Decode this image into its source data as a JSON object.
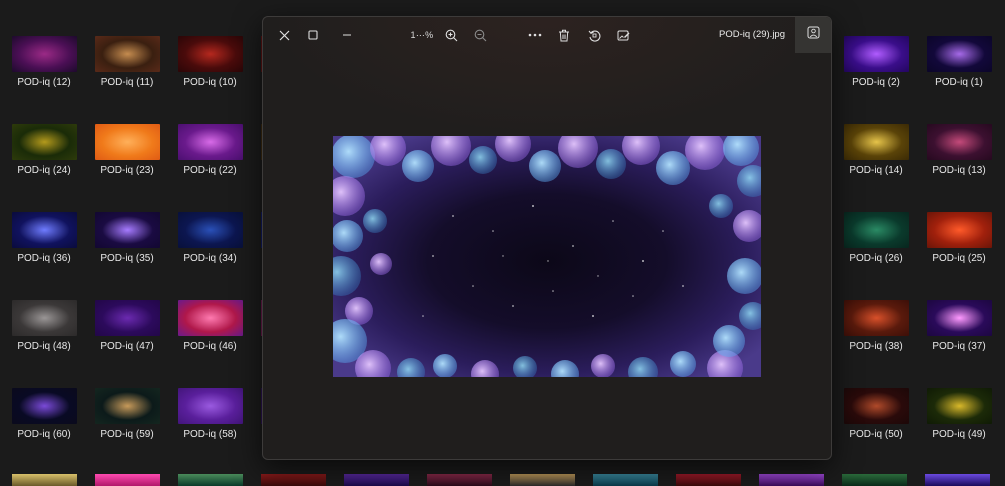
{
  "colors": {
    "background": "#1b1b1b",
    "viewer_background": "#201e1d",
    "active_button": "#353432"
  },
  "gallery": {
    "left_items": [
      {
        "label": "POD-iq (12)",
        "colors": [
          "#4b0f55",
          "#9b2a86",
          "#1d0a2c"
        ]
      },
      {
        "label": "POD-iq (11)",
        "colors": [
          "#3a1f10",
          "#c58c4f",
          "#5a2a19"
        ]
      },
      {
        "label": "POD-iq (10)",
        "colors": [
          "#4a0b0b",
          "#b5281e",
          "#2a0607"
        ]
      },
      {
        "label": "POD-iq (24)",
        "colors": [
          "#1a2b08",
          "#b49a1c",
          "#2e3b0b"
        ]
      },
      {
        "label": "POD-iq (23)",
        "colors": [
          "#f07a1a",
          "#ffb05a",
          "#e05a14"
        ]
      },
      {
        "label": "POD-iq (22)",
        "colors": [
          "#6a1a8c",
          "#d86be8",
          "#4b0f70"
        ]
      },
      {
        "label": "POD-iq (36)",
        "colors": [
          "#10125e",
          "#6f7cff",
          "#0a0b3c"
        ]
      },
      {
        "label": "POD-iq (35)",
        "colors": [
          "#1a0b42",
          "#a67bff",
          "#120731"
        ]
      },
      {
        "label": "POD-iq (34)",
        "colors": [
          "#0c1650",
          "#2a50b8",
          "#08103a"
        ]
      },
      {
        "label": "POD-iq (48)",
        "colors": [
          "#3b3838",
          "#9a9696",
          "#2c2a2a"
        ]
      },
      {
        "label": "POD-iq (47)",
        "colors": [
          "#2c0a5c",
          "#6b2ab0",
          "#220748"
        ]
      },
      {
        "label": "POD-iq (46)",
        "colors": [
          "#b0184a",
          "#ff7ab0",
          "#6a1a8c"
        ]
      },
      {
        "label": "POD-iq (60)",
        "colors": [
          "#090a24",
          "#7a4ad8",
          "#0a0a1c"
        ]
      },
      {
        "label": "POD-iq (59)",
        "colors": [
          "#0c1a1a",
          "#c79a5a",
          "#14261f"
        ]
      },
      {
        "label": "POD-iq (58)",
        "colors": [
          "#5a1f9c",
          "#9a5ae0",
          "#42157a"
        ]
      }
    ],
    "right_items": [
      {
        "label": "POD-iq (2)",
        "colors": [
          "#3a0e8a",
          "#b05cff",
          "#230660"
        ]
      },
      {
        "label": "POD-iq (1)",
        "colors": [
          "#12083a",
          "#a66ae8",
          "#0b0628"
        ]
      },
      {
        "label": "POD-iq (14)",
        "colors": [
          "#5a4308",
          "#e6c44a",
          "#3b2a05"
        ]
      },
      {
        "label": "POD-iq (13)",
        "colors": [
          "#3c1030",
          "#c44a7a",
          "#26091f"
        ]
      },
      {
        "label": "POD-iq (26)",
        "colors": [
          "#0a3a2c",
          "#2a8a64",
          "#08261e"
        ]
      },
      {
        "label": "POD-iq (25)",
        "colors": [
          "#a0200c",
          "#ff5a2a",
          "#6a1508"
        ]
      },
      {
        "label": "POD-iq (38)",
        "colors": [
          "#5a1a0c",
          "#d8502a",
          "#3c0f08"
        ]
      },
      {
        "label": "POD-iq (37)",
        "colors": [
          "#2a0a5a",
          "#ff9aff",
          "#1c0740"
        ]
      },
      {
        "label": "POD-iq (50)",
        "colors": [
          "#2a0a0a",
          "#b04a2a",
          "#1c0808"
        ]
      },
      {
        "label": "POD-iq (49)",
        "colors": [
          "#1c2a08",
          "#d8b82a",
          "#0f1a05"
        ]
      }
    ],
    "bottom_partial": [
      [
        "#6a5a2a",
        "#d8c06a"
      ],
      [
        "#b0186a",
        "#ff4ab0"
      ],
      [
        "#0a3a2a",
        "#4a8a5a"
      ],
      [
        "#3a0a0a",
        "#8a1a1a"
      ],
      [
        "#1a0a4a",
        "#5a2aa0"
      ],
      [
        "#2a0a1a",
        "#8a2a4a"
      ],
      [
        "#2a2a2a",
        "#c09a5a"
      ],
      [
        "#0a3a4a",
        "#3a8aa0"
      ],
      [
        "#3a0a0a",
        "#a01a2a"
      ],
      [
        "#3a0a5a",
        "#a04ad8"
      ],
      [
        "#0a2a1a",
        "#2a6a3a"
      ],
      [
        "#1a0a5a",
        "#6a4ae0"
      ]
    ]
  },
  "viewer": {
    "zoom_level": "1⋯%",
    "filename": "POD-iq (29).jpg",
    "icons": {
      "close": "close-icon",
      "maximize": "maximize-icon",
      "minimize": "minimize-icon",
      "zoom_in": "zoom-in-icon",
      "zoom_out": "zoom-out-icon",
      "more": "more-icon",
      "delete": "delete-icon",
      "rotate": "rotate-icon",
      "edit": "edit-image-icon",
      "info": "image-info-icon"
    }
  }
}
